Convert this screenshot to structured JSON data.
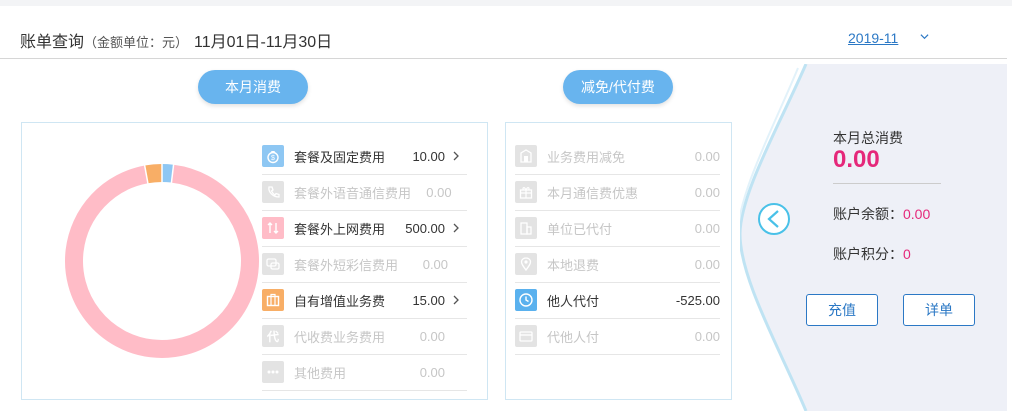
{
  "header": {
    "title": "账单查询",
    "unit": "（金额单位：元）",
    "date_range": "11月01日-11月30日",
    "month": "2019-11"
  },
  "tabs": {
    "consumption": "本月消费",
    "discount": "减免/代付费"
  },
  "chart_data": {
    "type": "pie",
    "donut": true,
    "categories": [
      "套餐及固定费用",
      "套餐外上网费用",
      "自有增值业务费"
    ],
    "values": [
      10.0,
      500.0,
      15.0
    ],
    "colors": [
      "#8ec7f3",
      "#ffbcc7",
      "#f8ae66"
    ]
  },
  "consumption_items": [
    {
      "label": "套餐及固定费用",
      "amount": "10.00",
      "active": true,
      "icon": "money-bag-icon",
      "color": "#8ec7f3"
    },
    {
      "label": "套餐外语音通信费用",
      "amount": "0.00",
      "active": false,
      "icon": "phone-icon",
      "color": "#e3e3e3"
    },
    {
      "label": "套餐外上网费用",
      "amount": "500.00",
      "active": true,
      "icon": "data-arrows-icon",
      "color": "#ffbcc7"
    },
    {
      "label": "套餐外短彩信费用",
      "amount": "0.00",
      "active": false,
      "icon": "message-icon",
      "color": "#e3e3e3"
    },
    {
      "label": "自有增值业务费",
      "amount": "15.00",
      "active": true,
      "icon": "briefcase-icon",
      "color": "#f8ae66"
    },
    {
      "label": "代收费业务费用",
      "amount": "0.00",
      "active": false,
      "icon": "collect-icon",
      "color": "#e3e3e3"
    },
    {
      "label": "其他费用",
      "amount": "0.00",
      "active": false,
      "icon": "more-icon",
      "color": "#e3e3e3"
    }
  ],
  "discount_items": [
    {
      "label": "业务费用减免",
      "amount": "0.00",
      "active": false,
      "icon": "building-icon",
      "color": "#e3e3e3"
    },
    {
      "label": "本月通信费优惠",
      "amount": "0.00",
      "active": false,
      "icon": "gift-icon",
      "color": "#e3e3e3"
    },
    {
      "label": "单位已代付",
      "amount": "0.00",
      "active": false,
      "icon": "company-icon",
      "color": "#e3e3e3"
    },
    {
      "label": "本地退费",
      "amount": "0.00",
      "active": false,
      "icon": "location-icon",
      "color": "#e3e3e3"
    },
    {
      "label": "他人代付",
      "amount": "-525.00",
      "active": true,
      "icon": "clock-icon",
      "color": "#5ab1ee"
    },
    {
      "label": "代他人付",
      "amount": "0.00",
      "active": false,
      "icon": "card-icon",
      "color": "#e3e3e3"
    }
  ],
  "summary": {
    "total_label": "本月总消费",
    "total_value": "0.00",
    "balance_label": "账户余额：",
    "balance_value": "0.00",
    "points_label": "账户积分：",
    "points_value": "0"
  },
  "buttons": {
    "recharge": "充值",
    "detail": "详单"
  },
  "colors": {
    "accent": "#68b4ee",
    "link": "#2b78c5",
    "highlight": "#e5287a"
  }
}
